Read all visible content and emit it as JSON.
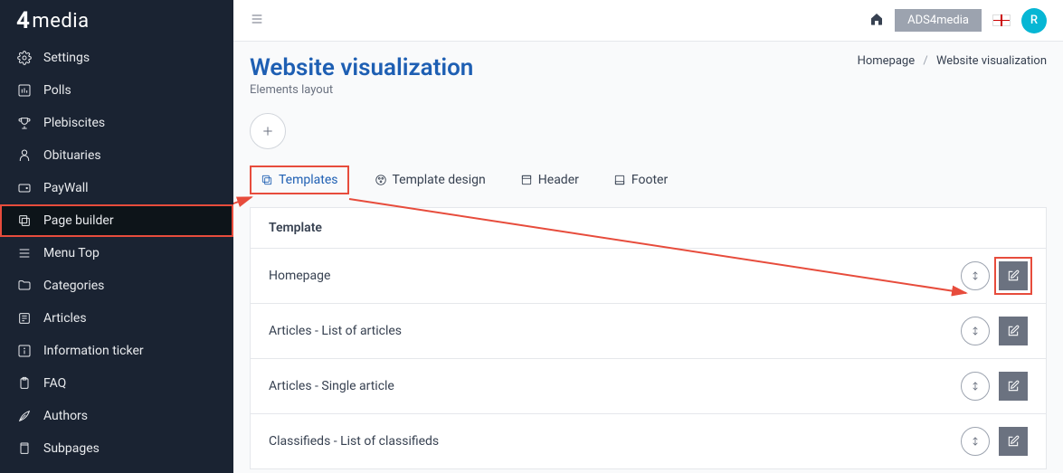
{
  "brand": {
    "mark": "4",
    "text": "media"
  },
  "sidebar": {
    "items": [
      {
        "label": "Settings"
      },
      {
        "label": "Polls"
      },
      {
        "label": "Plebiscites"
      },
      {
        "label": "Obituaries"
      },
      {
        "label": "PayWall"
      },
      {
        "label": "Page builder"
      },
      {
        "label": "Menu Top"
      },
      {
        "label": "Categories"
      },
      {
        "label": "Articles"
      },
      {
        "label": "Information ticker"
      },
      {
        "label": "FAQ"
      },
      {
        "label": "Authors"
      },
      {
        "label": "Subpages"
      }
    ]
  },
  "topbar": {
    "account": "ADS4media",
    "avatar_initial": "R"
  },
  "page": {
    "title": "Website visualization",
    "subtitle": "Elements layout"
  },
  "breadcrumb": {
    "item0": "Homepage",
    "item1": "Website visualization"
  },
  "tabs": {
    "templates": "Templates",
    "template_design": "Template design",
    "header": "Header",
    "footer": "Footer"
  },
  "panel": {
    "heading": "Template",
    "rows": [
      {
        "label": "Homepage"
      },
      {
        "label": "Articles - List of articles"
      },
      {
        "label": "Articles - Single article"
      },
      {
        "label": "Classifieds - List of classifieds"
      }
    ]
  }
}
